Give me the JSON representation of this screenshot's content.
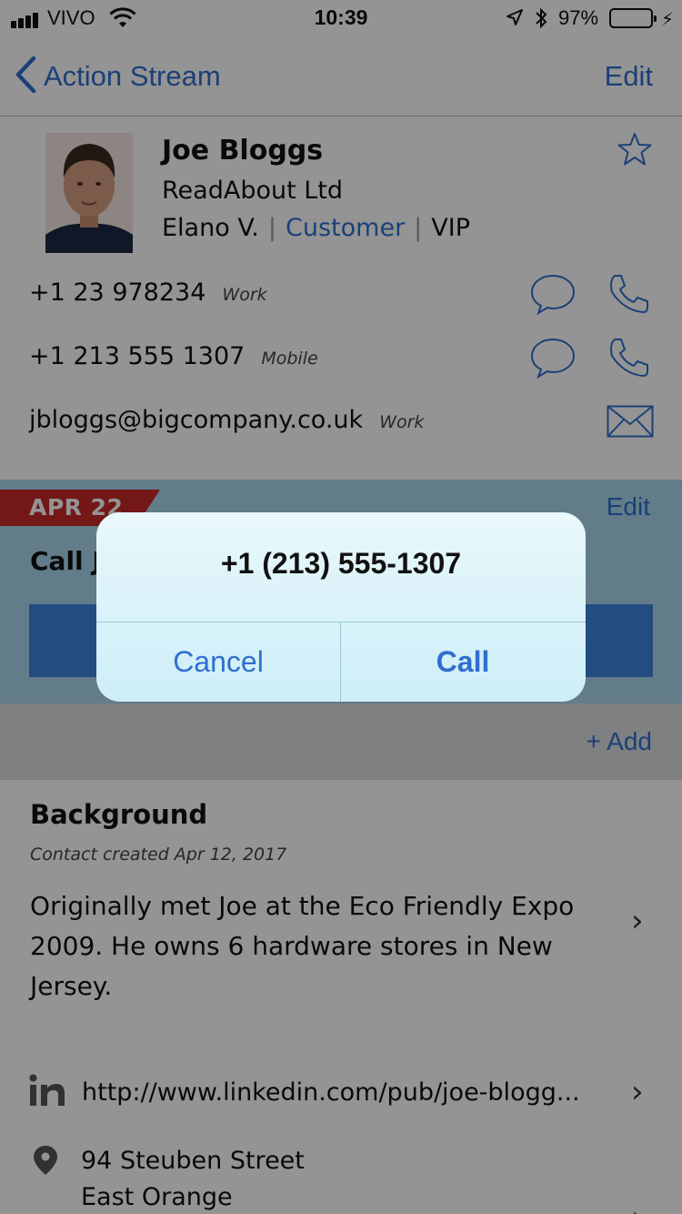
{
  "status_bar": {
    "carrier": "VIVO",
    "time": "10:39",
    "battery": "97%"
  },
  "nav": {
    "back_label": "Action Stream",
    "edit_label": "Edit"
  },
  "contact": {
    "name": "Joe Bloggs",
    "company": "ReadAbout Ltd",
    "owner": "Elano V.",
    "type": "Customer",
    "tier": "VIP",
    "phones": [
      {
        "number": "+1 23 978234",
        "kind": "Work"
      },
      {
        "number": "+1 213 555 1307",
        "kind": "Mobile"
      }
    ],
    "email": {
      "address": "jbloggs@bigcompany.co.uk",
      "kind": "Work"
    }
  },
  "action": {
    "date": "APR 22",
    "edit_label": "Edit",
    "title": "Call J"
  },
  "add_label": "+ Add",
  "background": {
    "title": "Background",
    "created": "Contact created Apr 12, 2017",
    "notes": "Originally met Joe at the Eco Friendly Expo 2009. He owns 6 hardware stores in New Jersey."
  },
  "linkedin_url": "http://www.linkedin.com/pub/joe-blogg...",
  "address": {
    "line1": "94 Steuben Street",
    "line2": "East Orange"
  },
  "alert": {
    "message": "+1 (213) 555-1307",
    "cancel_label": "Cancel",
    "call_label": "Call"
  },
  "colors": {
    "accent": "#2f6fcf",
    "date_tag": "#c62828",
    "action_bg": "#a9d8ec"
  }
}
